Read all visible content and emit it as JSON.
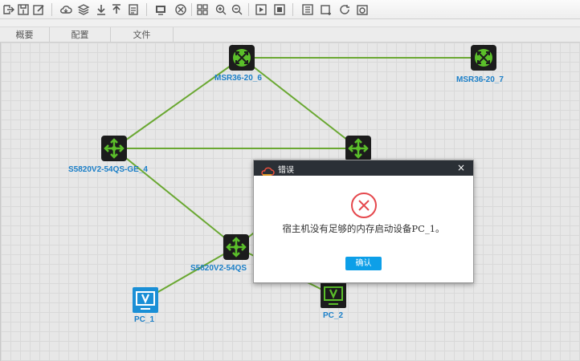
{
  "toolbar": {
    "buttons": [
      "export-icon",
      "save-icon",
      "edit-icon",
      "cloud-icon",
      "layers-icon",
      "download-icon",
      "upload-icon",
      "document-icon",
      "screen-icon",
      "settings-circle-icon",
      "grid-icon",
      "zoom-in-icon",
      "zoom-out-icon",
      "play-icon",
      "stop-icon",
      "list-icon",
      "add-window-icon",
      "refresh-icon",
      "camera-icon"
    ]
  },
  "tabs": [
    {
      "label": "概要"
    },
    {
      "label": "配置"
    },
    {
      "label": "文件"
    }
  ],
  "devices": {
    "r6": {
      "label": "MSR36-20_6",
      "type": "router"
    },
    "r7": {
      "label": "MSR36-20_7",
      "type": "router"
    },
    "s4": {
      "label": "S5820V2-54QS-GE_4",
      "type": "switch"
    },
    "s5": {
      "label": "S5820V2-54QS",
      "type": "switch"
    },
    "s_hidden": {
      "label": "",
      "type": "switch"
    },
    "pc1": {
      "label": "PC_1",
      "type": "pc"
    },
    "pc2": {
      "label": "PC_2",
      "type": "pc"
    }
  },
  "colors": {
    "link": "#6aa832",
    "label": "#1b7fc8",
    "device_green": "#5bbf2a",
    "button": "#0d9fe8",
    "error": "#e5484d"
  },
  "dialog": {
    "title": "错误",
    "close": "×",
    "message": "宿主机没有足够的内存启动设备PC_1。",
    "ok_label": "确认"
  }
}
